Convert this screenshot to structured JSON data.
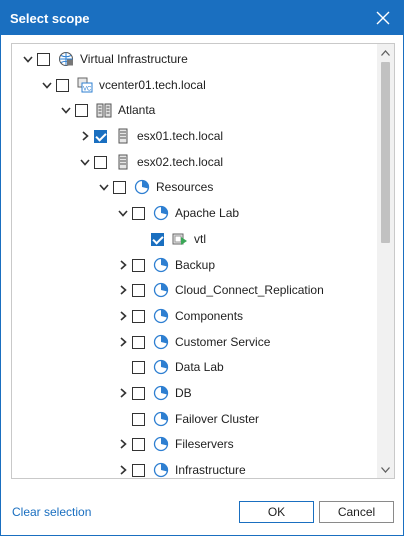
{
  "dialog": {
    "title": "Select scope",
    "close_icon": "close-icon"
  },
  "tree": [
    {
      "level": 0,
      "label": "Virtual Infrastructure",
      "expanded": true,
      "checked": false,
      "icon": "virtual-infrastructure-icon"
    },
    {
      "level": 1,
      "label": "vcenter01.tech.local",
      "expanded": true,
      "checked": false,
      "icon": "vcenter-icon"
    },
    {
      "level": 2,
      "label": "Atlanta",
      "expanded": true,
      "checked": false,
      "icon": "datacenter-icon"
    },
    {
      "level": 3,
      "label": "esx01.tech.local",
      "expanded": false,
      "checked": true,
      "icon": "host-icon"
    },
    {
      "level": 3,
      "label": "esx02.tech.local",
      "expanded": true,
      "checked": false,
      "icon": "host-icon"
    },
    {
      "level": 4,
      "label": "Resources",
      "expanded": true,
      "checked": false,
      "icon": "resource-pool-icon"
    },
    {
      "level": 5,
      "label": "Apache Lab",
      "expanded": true,
      "checked": false,
      "icon": "resource-pool-icon"
    },
    {
      "level": 6,
      "label": "vtl",
      "expanded": null,
      "checked": true,
      "icon": "vm-icon"
    },
    {
      "level": 5,
      "label": "Backup",
      "expanded": false,
      "checked": false,
      "icon": "resource-pool-icon"
    },
    {
      "level": 5,
      "label": "Cloud_Connect_Replication",
      "expanded": false,
      "checked": false,
      "icon": "resource-pool-icon"
    },
    {
      "level": 5,
      "label": "Components",
      "expanded": false,
      "checked": false,
      "icon": "resource-pool-icon"
    },
    {
      "level": 5,
      "label": "Customer Service",
      "expanded": false,
      "checked": false,
      "icon": "resource-pool-icon"
    },
    {
      "level": 5,
      "label": "Data Lab",
      "expanded": null,
      "checked": false,
      "icon": "resource-pool-icon"
    },
    {
      "level": 5,
      "label": "DB",
      "expanded": false,
      "checked": false,
      "icon": "resource-pool-icon"
    },
    {
      "level": 5,
      "label": "Failover Cluster",
      "expanded": null,
      "checked": false,
      "icon": "resource-pool-icon"
    },
    {
      "level": 5,
      "label": "Fileservers",
      "expanded": false,
      "checked": false,
      "icon": "resource-pool-icon"
    },
    {
      "level": 5,
      "label": "Infrastructure",
      "expanded": false,
      "checked": false,
      "icon": "resource-pool-icon"
    }
  ],
  "footer": {
    "clear_label": "Clear selection",
    "ok_label": "OK",
    "cancel_label": "Cancel"
  },
  "colors": {
    "accent": "#1a6fc0",
    "title_text": "#ffffff",
    "pool_icon": "#2e7fd1",
    "vm_icon": "#3aa757"
  }
}
